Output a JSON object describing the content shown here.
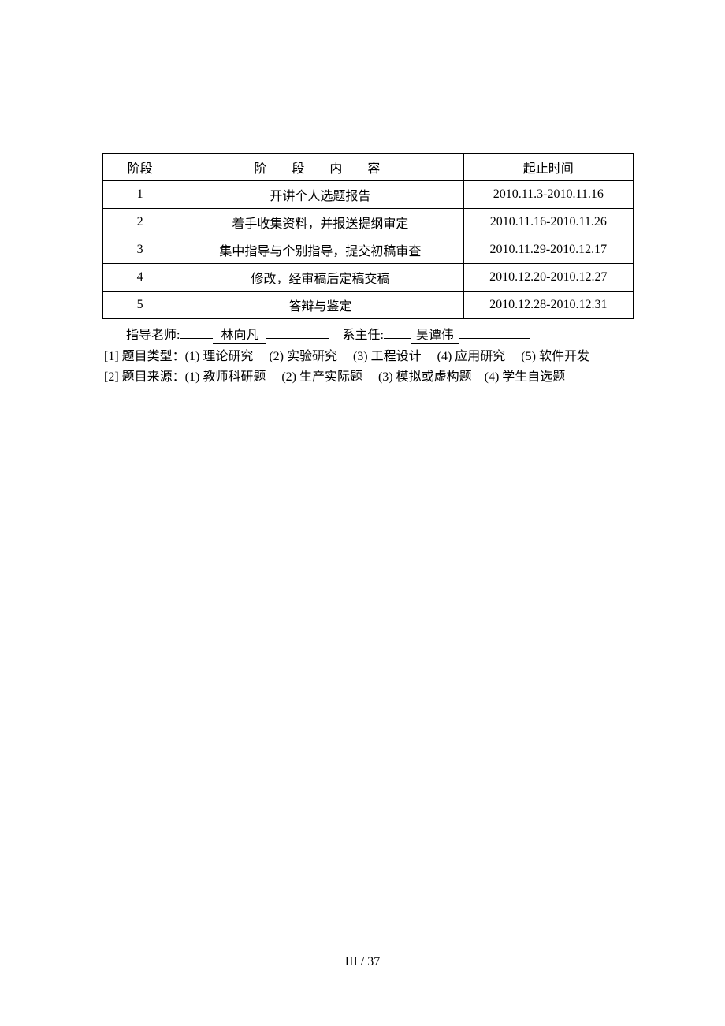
{
  "table": {
    "headers": {
      "phase": "阶段",
      "content": "阶　段　内　容",
      "time": "起止时间"
    },
    "rows": [
      {
        "phase": "1",
        "content": "开讲个人选题报告",
        "time": "2010.11.3-2010.11.16"
      },
      {
        "phase": "2",
        "content": "着手收集资料，并报送提纲审定",
        "time": "2010.11.16-2010.11.26"
      },
      {
        "phase": "3",
        "content": "集中指导与个别指导，提交初稿审查",
        "time": "2010.11.29-2010.12.17"
      },
      {
        "phase": "4",
        "content": "修改，经审稿后定稿交稿",
        "time": "2010.12.20-2010.12.27"
      },
      {
        "phase": "5",
        "content": "答辩与鉴定",
        "time": "2010.12.28-2010.12.31"
      }
    ]
  },
  "signatures": {
    "advisor_label": "指导老师:",
    "advisor_name": "林向凡",
    "dept_head_label": "系主任:",
    "dept_head_name": "吴谭伟"
  },
  "notes": {
    "line1_prefix": " [1] 题目类型：(1) 理论研究　 (2) 实验研究　  (3) 工程设计　  (4) 应用研究　 (5) 软件开发",
    "line2_prefix": " [2] 题目来源：(1) 教师科研题　 (2) 生产实际题　 (3) 模拟或虚构题　(4) 学生自选题"
  },
  "pagination": "III  / 37"
}
